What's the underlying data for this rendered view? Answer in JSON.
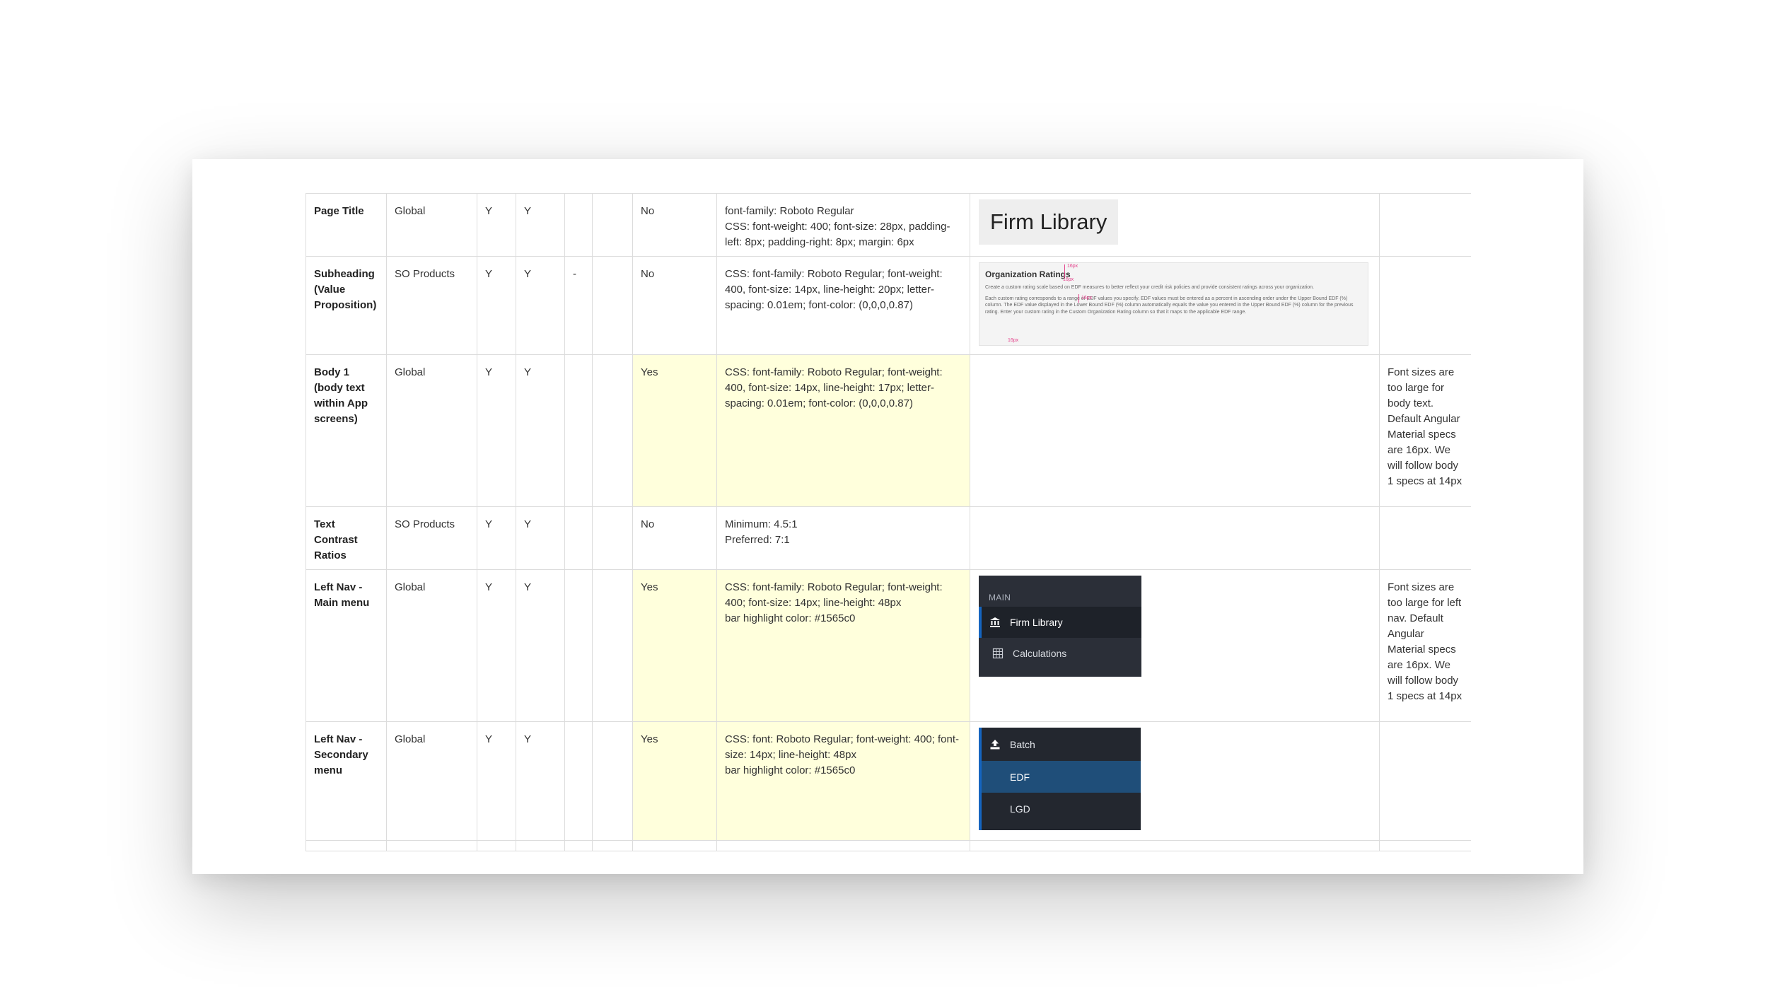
{
  "rows": [
    {
      "name": "Page Title",
      "scope": "Global",
      "c3": "Y",
      "c4": "Y",
      "c5": "",
      "c6": "",
      "status": "No",
      "spec_lines": [
        "font-family: Roboto Regular",
        "CSS: font-weight: 400; font-size: 28px, padding-left: 8px; padding-right: 8px; margin: 6px"
      ],
      "example_text": "Firm Library",
      "notes": ""
    },
    {
      "name": "Subheading (Value Proposition)",
      "scope": "SO Products",
      "c3": "Y",
      "c4": "Y",
      "c5": "-",
      "c6": "",
      "status": "No",
      "spec": "CSS: font-family: Roboto Regular; font-weight: 400, font-size: 14px, line-height: 20px; letter-spacing: 0.01em; font-color: (0,0,0,0.87)",
      "example": {
        "title": "Organization Ratings",
        "p1": "Create a custom rating scale based on EDF measures to better reflect your credit risk policies and provide consistent ratings across your organization.",
        "p2": "Each custom rating corresponds to a range of EDF values you specify. EDF values must be entered as a percent in ascending order under the Upper Bound EDF (%) column. The EDF value displayed in the Lower Bound EDF (%) column automatically equals the value you entered in the Upper Bound EDF (%) column for the previous rating. Enter your custom rating in the Custom Organization Rating column so that it maps to the applicable EDF range.",
        "spec_labels": [
          "16px",
          "16px",
          "16px",
          "16px"
        ]
      },
      "notes": ""
    },
    {
      "name": "Body 1 (body text within App screens)",
      "scope": "Global",
      "c3": "Y",
      "c4": "Y",
      "c5": "",
      "c6": "",
      "status": "Yes",
      "spec": "CSS: font-family: Roboto Regular; font-weight: 400, font-size: 14px, line-height: 17px; letter-spacing: 0.01em; font-color: (0,0,0,0.87)",
      "notes": "Font sizes are too large for body text. Default Angular Material specs are 16px. We will follow body 1 specs at 14px"
    },
    {
      "name": "Text Contrast Ratios",
      "scope": "SO Products",
      "c3": "Y",
      "c4": "Y",
      "c5": "",
      "c6": "",
      "status": "No",
      "spec_lines": [
        "Minimum: 4.5:1",
        "Preferred: 7:1"
      ],
      "notes": ""
    },
    {
      "name": "Left Nav - Main menu",
      "scope": "Global",
      "c3": "Y",
      "c4": "Y",
      "c5": "",
      "c6": "",
      "status": "Yes",
      "spec_lines": [
        "CSS: font-family: Roboto Regular; font-weight: 400; font-size: 14px; line-height: 48px",
        "bar highlight color: #1565c0"
      ],
      "example": {
        "header": "MAIN",
        "items": [
          {
            "label": "Firm Library",
            "icon": "bank-icon"
          },
          {
            "label": "Calculations",
            "icon": "calculator-icon"
          }
        ]
      },
      "notes": "Font sizes are too large for left nav. Default Angular Material specs are 16px. We will follow body 1 specs at 14px"
    },
    {
      "name": "Left Nav - Secondary menu",
      "scope": "Global",
      "c3": "Y",
      "c4": "Y",
      "c5": "",
      "c6": "",
      "status": "Yes",
      "spec_lines": [
        "CSS: font: Roboto Regular; font-weight: 400; font-size: 14px; line-height: 48px",
        "bar highlight color: #1565c0"
      ],
      "example": {
        "items": [
          {
            "label": "Batch",
            "icon": "upload-icon"
          },
          {
            "label": "EDF"
          },
          {
            "label": "LGD"
          }
        ]
      },
      "notes": ""
    }
  ],
  "colors": {
    "highlight_yellow": "#ffffdc",
    "nav_bar_highlight": "#1565c0",
    "nav_bg": "#2b2f38",
    "spec_pink": "#e4408a"
  }
}
